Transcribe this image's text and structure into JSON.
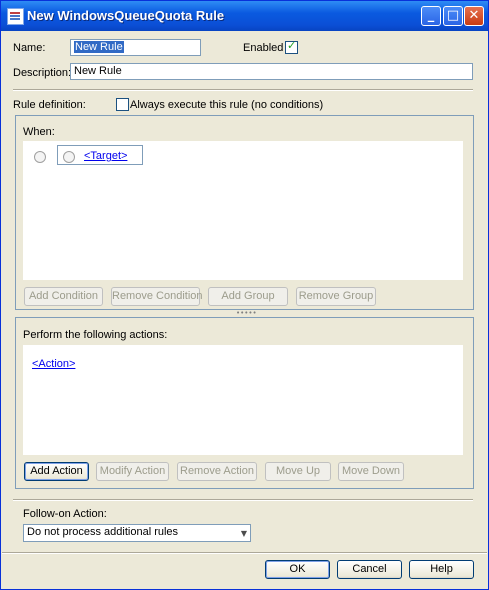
{
  "window": {
    "title": "New WindowsQueueQuota Rule"
  },
  "form": {
    "name_label": "Name:",
    "name_value": "New Rule",
    "enabled_label": "Enabled",
    "enabled_checked": true,
    "description_label": "Description:",
    "description_value": "New Rule",
    "rule_definition_label": "Rule definition:",
    "always_execute_label": "Always execute this rule (no conditions)",
    "always_execute_checked": false
  },
  "when": {
    "label": "When:",
    "target_link": "<Target>",
    "buttons": {
      "add_condition": "Add Condition",
      "remove_condition": "Remove Condition",
      "add_group": "Add Group",
      "remove_group": "Remove Group"
    }
  },
  "actions": {
    "label": "Perform the following actions:",
    "action_link": "<Action>",
    "buttons": {
      "add_action": "Add Action",
      "modify_action": "Modify Action",
      "remove_action": "Remove Action",
      "move_up": "Move Up",
      "move_down": "Move Down"
    }
  },
  "follow_on": {
    "label": "Follow-on Action:",
    "selected": "Do not process additional rules"
  },
  "footer": {
    "ok": "OK",
    "cancel": "Cancel",
    "help": "Help"
  },
  "colors": {
    "titlebar": "#0b4fd6",
    "dialog_bg": "#ece9d8",
    "link": "#0000ee",
    "checkmark": "#21a121"
  },
  "icons": {
    "app": "app-window-icon",
    "minimize": "minimize-icon",
    "maximize": "maximize-icon",
    "close": "close-icon"
  }
}
